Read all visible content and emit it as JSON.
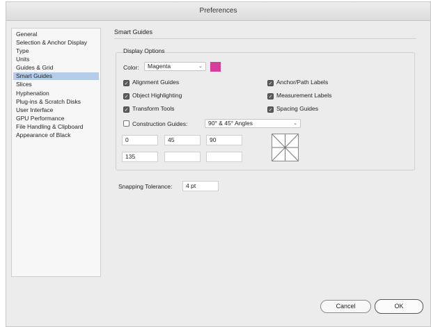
{
  "window": {
    "title": "Preferences"
  },
  "sidebar": {
    "items": [
      {
        "label": "General"
      },
      {
        "label": "Selection & Anchor Display"
      },
      {
        "label": "Type"
      },
      {
        "label": "Units"
      },
      {
        "label": "Guides & Grid"
      },
      {
        "label": "Smart Guides",
        "selected": true
      },
      {
        "label": "Slices"
      },
      {
        "label": "Hyphenation"
      },
      {
        "label": "Plug-ins & Scratch Disks"
      },
      {
        "label": "User Interface"
      },
      {
        "label": "GPU Performance"
      },
      {
        "label": "File Handling & Clipboard"
      },
      {
        "label": "Appearance of Black"
      }
    ]
  },
  "main": {
    "section_title": "Smart Guides",
    "display_options": {
      "title": "Display Options",
      "color_label": "Color:",
      "color_value": "Magenta",
      "swatch_color": "#d63c9a",
      "checkboxes": {
        "alignment_guides": {
          "label": "Alignment Guides",
          "checked": true
        },
        "object_highlighting": {
          "label": "Object Highlighting",
          "checked": true
        },
        "transform_tools": {
          "label": "Transform Tools",
          "checked": true
        },
        "anchor_path_labels": {
          "label": "Anchor/Path Labels",
          "checked": true
        },
        "measurement_labels": {
          "label": "Measurement Labels",
          "checked": true
        },
        "spacing_guides": {
          "label": "Spacing Guides",
          "checked": true
        },
        "construction_guides": {
          "label": "Construction Guides:",
          "checked": false
        }
      },
      "construction_angles_value": "90° & 45° Angles",
      "angle_fields": [
        "0",
        "45",
        "90",
        "135",
        "",
        ""
      ]
    },
    "snapping_tolerance": {
      "label": "Snapping Tolerance:",
      "value": "4 pt"
    }
  },
  "buttons": {
    "cancel": "Cancel",
    "ok": "OK"
  }
}
